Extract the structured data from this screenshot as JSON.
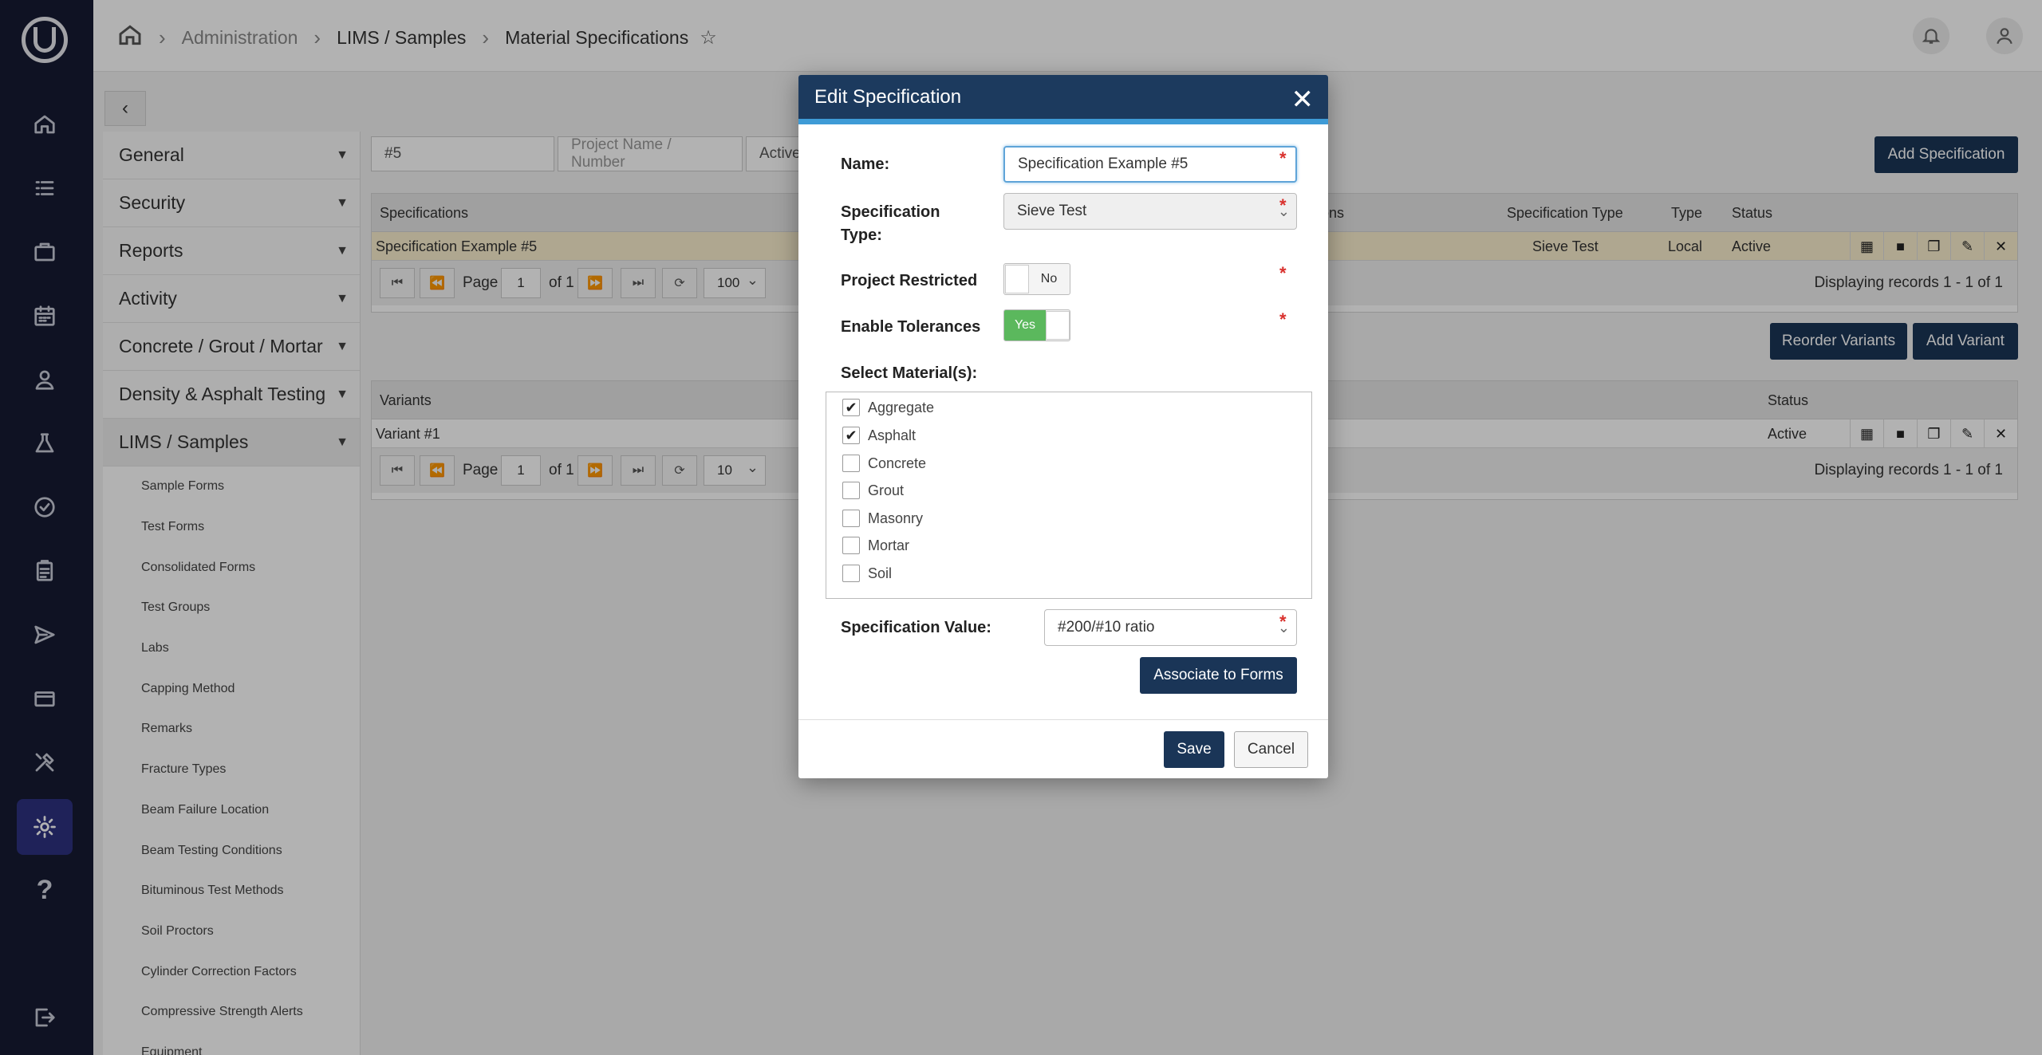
{
  "rail": {
    "icons": [
      "home-icon",
      "list-icon",
      "briefcase-icon",
      "calendar-icon",
      "user-badge-icon",
      "flask-icon",
      "verified-icon",
      "clipboard-icon",
      "send-icon",
      "card-icon",
      "tools-icon",
      "gear-icon",
      "help-icon",
      "logout-icon"
    ],
    "active": "gear-icon",
    "help_glyph": "?"
  },
  "header": {
    "breadcrumbs": [
      "Administration",
      "LIMS / Samples",
      "Material Specifications"
    ]
  },
  "sidenav": {
    "sections": [
      "General",
      "Security",
      "Reports",
      "Activity",
      "Concrete / Grout / Mortar",
      "Density & Asphalt Testing",
      "LIMS / Samples"
    ],
    "open_section": "LIMS / Samples",
    "sub_items": [
      "Sample Forms",
      "Test Forms",
      "Consolidated Forms",
      "Test Groups",
      "Labs",
      "Capping Method",
      "Remarks",
      "Fracture Types",
      "Beam Failure Location",
      "Beam Testing Conditions",
      "Bituminous Test Methods",
      "Soil Proctors",
      "Cylinder Correction Factors",
      "Compressive Strength Alerts",
      "Equipment"
    ]
  },
  "filters": {
    "search_value": "#5",
    "project_placeholder": "Project Name / Number",
    "status_value": "Active"
  },
  "toolbar": {
    "add_specification": "Add Specification",
    "reorder_variants": "Reorder Variants",
    "add_variant": "Add Variant"
  },
  "spec_grid": {
    "columns": [
      "Specifications",
      "ons",
      "Specification Type",
      "Type",
      "Status"
    ],
    "row": {
      "name": "Specification Example #5",
      "spec_type": "Sieve Test",
      "type": "Local",
      "status": "Active"
    },
    "pager": {
      "page_label": "Page",
      "page": "1",
      "of": "of 1",
      "page_size": "100",
      "display": "Displaying records  1 - 1  of  1"
    }
  },
  "variant_grid": {
    "columns": [
      "Variants",
      "Status"
    ],
    "row": {
      "name": "Variant #1",
      "status": "Active"
    },
    "pager": {
      "page_label": "Page",
      "page": "1",
      "of": "of 1",
      "page_size": "10",
      "display": "Displaying records  1 - 1  of  1"
    }
  },
  "modal": {
    "title": "Edit Specification",
    "close_glyph": "✕",
    "name_label": "Name:",
    "name_value": "Specification Example #5",
    "spec_type_label": "Specification Type:",
    "spec_type_value": "Sieve Test",
    "project_restricted_label": "Project Restricted",
    "project_restricted_value": "No",
    "enable_tolerances_label": "Enable Tolerances",
    "enable_tolerances_value": "Yes",
    "materials_label": "Select Material(s):",
    "materials": [
      {
        "label": "Aggregate",
        "checked": true
      },
      {
        "label": "Asphalt",
        "checked": true
      },
      {
        "label": "Concrete",
        "checked": false
      },
      {
        "label": "Grout",
        "checked": false
      },
      {
        "label": "Masonry",
        "checked": false
      },
      {
        "label": "Mortar",
        "checked": false
      },
      {
        "label": "Soil",
        "checked": false
      }
    ],
    "spec_value_label": "Specification Value:",
    "spec_value": "#200/#10 ratio",
    "associate_button": "Associate to Forms",
    "save_button": "Save",
    "cancel_button": "Cancel",
    "required_glyph": "*",
    "check_glyph": "✔"
  },
  "colors": {
    "rail_bg": "#161b33",
    "modal_header": "#1c3a5e",
    "modal_header_stripe": "#3e9bd6",
    "primary_button": "#1a3557",
    "selected_row": "#fbf0cf",
    "toggle_on": "#5bb85d",
    "required": "#d9302c"
  }
}
